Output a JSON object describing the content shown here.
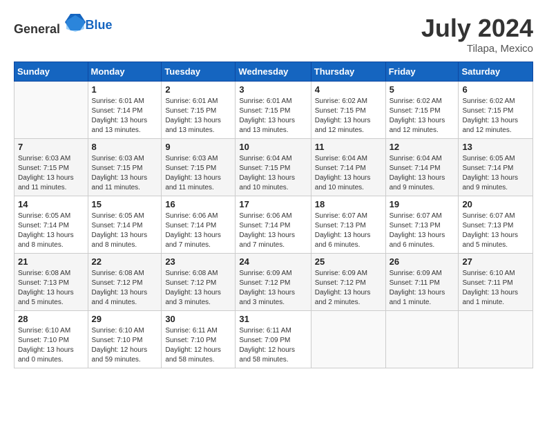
{
  "header": {
    "logo_general": "General",
    "logo_blue": "Blue",
    "month_year": "July 2024",
    "location": "Tilapa, Mexico"
  },
  "weekdays": [
    "Sunday",
    "Monday",
    "Tuesday",
    "Wednesday",
    "Thursday",
    "Friday",
    "Saturday"
  ],
  "weeks": [
    [
      {
        "day": "",
        "info": ""
      },
      {
        "day": "1",
        "info": "Sunrise: 6:01 AM\nSunset: 7:14 PM\nDaylight: 13 hours\nand 13 minutes."
      },
      {
        "day": "2",
        "info": "Sunrise: 6:01 AM\nSunset: 7:15 PM\nDaylight: 13 hours\nand 13 minutes."
      },
      {
        "day": "3",
        "info": "Sunrise: 6:01 AM\nSunset: 7:15 PM\nDaylight: 13 hours\nand 13 minutes."
      },
      {
        "day": "4",
        "info": "Sunrise: 6:02 AM\nSunset: 7:15 PM\nDaylight: 13 hours\nand 12 minutes."
      },
      {
        "day": "5",
        "info": "Sunrise: 6:02 AM\nSunset: 7:15 PM\nDaylight: 13 hours\nand 12 minutes."
      },
      {
        "day": "6",
        "info": "Sunrise: 6:02 AM\nSunset: 7:15 PM\nDaylight: 13 hours\nand 12 minutes."
      }
    ],
    [
      {
        "day": "7",
        "info": "Sunrise: 6:03 AM\nSunset: 7:15 PM\nDaylight: 13 hours\nand 11 minutes."
      },
      {
        "day": "8",
        "info": "Sunrise: 6:03 AM\nSunset: 7:15 PM\nDaylight: 13 hours\nand 11 minutes."
      },
      {
        "day": "9",
        "info": "Sunrise: 6:03 AM\nSunset: 7:15 PM\nDaylight: 13 hours\nand 11 minutes."
      },
      {
        "day": "10",
        "info": "Sunrise: 6:04 AM\nSunset: 7:15 PM\nDaylight: 13 hours\nand 10 minutes."
      },
      {
        "day": "11",
        "info": "Sunrise: 6:04 AM\nSunset: 7:14 PM\nDaylight: 13 hours\nand 10 minutes."
      },
      {
        "day": "12",
        "info": "Sunrise: 6:04 AM\nSunset: 7:14 PM\nDaylight: 13 hours\nand 9 minutes."
      },
      {
        "day": "13",
        "info": "Sunrise: 6:05 AM\nSunset: 7:14 PM\nDaylight: 13 hours\nand 9 minutes."
      }
    ],
    [
      {
        "day": "14",
        "info": "Sunrise: 6:05 AM\nSunset: 7:14 PM\nDaylight: 13 hours\nand 8 minutes."
      },
      {
        "day": "15",
        "info": "Sunrise: 6:05 AM\nSunset: 7:14 PM\nDaylight: 13 hours\nand 8 minutes."
      },
      {
        "day": "16",
        "info": "Sunrise: 6:06 AM\nSunset: 7:14 PM\nDaylight: 13 hours\nand 7 minutes."
      },
      {
        "day": "17",
        "info": "Sunrise: 6:06 AM\nSunset: 7:14 PM\nDaylight: 13 hours\nand 7 minutes."
      },
      {
        "day": "18",
        "info": "Sunrise: 6:07 AM\nSunset: 7:13 PM\nDaylight: 13 hours\nand 6 minutes."
      },
      {
        "day": "19",
        "info": "Sunrise: 6:07 AM\nSunset: 7:13 PM\nDaylight: 13 hours\nand 6 minutes."
      },
      {
        "day": "20",
        "info": "Sunrise: 6:07 AM\nSunset: 7:13 PM\nDaylight: 13 hours\nand 5 minutes."
      }
    ],
    [
      {
        "day": "21",
        "info": "Sunrise: 6:08 AM\nSunset: 7:13 PM\nDaylight: 13 hours\nand 5 minutes."
      },
      {
        "day": "22",
        "info": "Sunrise: 6:08 AM\nSunset: 7:12 PM\nDaylight: 13 hours\nand 4 minutes."
      },
      {
        "day": "23",
        "info": "Sunrise: 6:08 AM\nSunset: 7:12 PM\nDaylight: 13 hours\nand 3 minutes."
      },
      {
        "day": "24",
        "info": "Sunrise: 6:09 AM\nSunset: 7:12 PM\nDaylight: 13 hours\nand 3 minutes."
      },
      {
        "day": "25",
        "info": "Sunrise: 6:09 AM\nSunset: 7:12 PM\nDaylight: 13 hours\nand 2 minutes."
      },
      {
        "day": "26",
        "info": "Sunrise: 6:09 AM\nSunset: 7:11 PM\nDaylight: 13 hours\nand 1 minute."
      },
      {
        "day": "27",
        "info": "Sunrise: 6:10 AM\nSunset: 7:11 PM\nDaylight: 13 hours\nand 1 minute."
      }
    ],
    [
      {
        "day": "28",
        "info": "Sunrise: 6:10 AM\nSunset: 7:10 PM\nDaylight: 13 hours\nand 0 minutes."
      },
      {
        "day": "29",
        "info": "Sunrise: 6:10 AM\nSunset: 7:10 PM\nDaylight: 12 hours\nand 59 minutes."
      },
      {
        "day": "30",
        "info": "Sunrise: 6:11 AM\nSunset: 7:10 PM\nDaylight: 12 hours\nand 58 minutes."
      },
      {
        "day": "31",
        "info": "Sunrise: 6:11 AM\nSunset: 7:09 PM\nDaylight: 12 hours\nand 58 minutes."
      },
      {
        "day": "",
        "info": ""
      },
      {
        "day": "",
        "info": ""
      },
      {
        "day": "",
        "info": ""
      }
    ]
  ]
}
